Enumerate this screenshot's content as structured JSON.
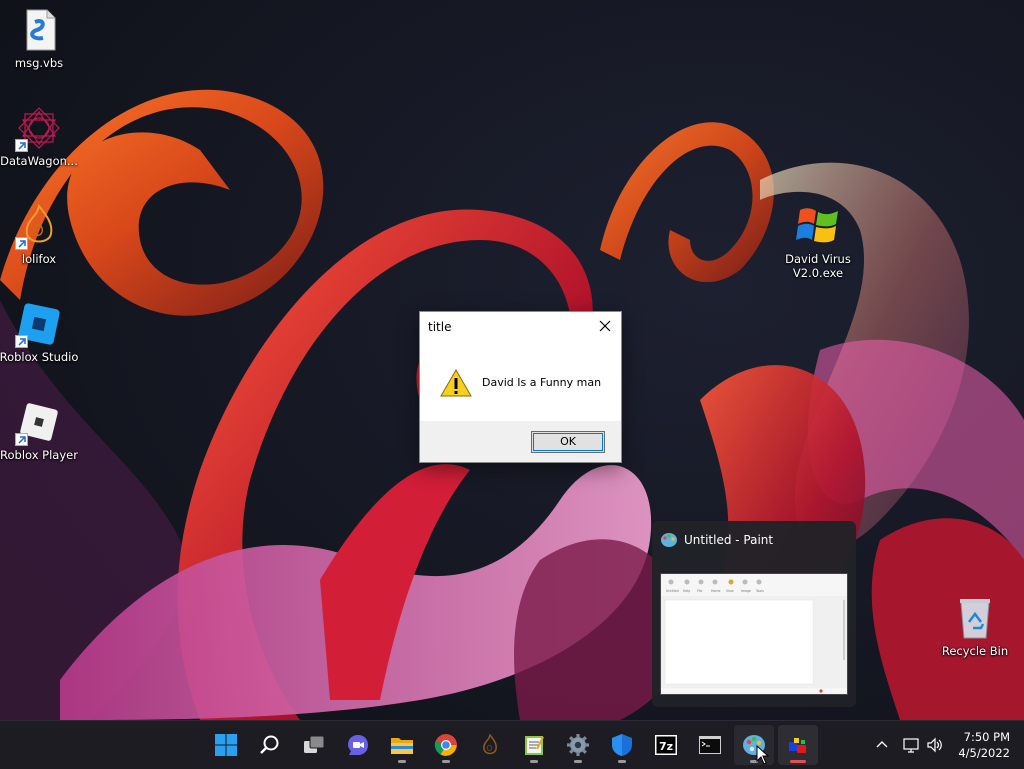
{
  "desktop": {
    "icons": [
      {
        "label": "msg.vbs"
      },
      {
        "label": "DataWagon..."
      },
      {
        "label": "lolifox"
      },
      {
        "label": "Roblox Studio"
      },
      {
        "label": "Roblox Player"
      },
      {
        "label": "David Virus V2.0.exe"
      },
      {
        "label": "Recycle Bin"
      }
    ]
  },
  "dialog": {
    "title": "title",
    "message": "David Is a Funny man",
    "ok_label": "OK",
    "icon": "warning-icon"
  },
  "preview": {
    "title": "Untitled - Paint",
    "thumb_labels": [
      "Untitled",
      "Help",
      "File",
      "Home",
      "View",
      "Image",
      "Tools"
    ]
  },
  "taskbar": {
    "apps": [
      {
        "name": "start",
        "icon": "windows-logo-icon"
      },
      {
        "name": "search",
        "icon": "search-icon"
      },
      {
        "name": "task-view",
        "icon": "task-view-icon"
      },
      {
        "name": "chat",
        "icon": "chat-icon"
      },
      {
        "name": "file-explorer",
        "icon": "folder-icon"
      },
      {
        "name": "chrome",
        "icon": "chrome-icon"
      },
      {
        "name": "lolifox",
        "icon": "lolifox-icon"
      },
      {
        "name": "notepad",
        "icon": "notepad-icon"
      },
      {
        "name": "settings",
        "icon": "gear-icon"
      },
      {
        "name": "security",
        "icon": "shield-icon"
      },
      {
        "name": "7zip",
        "icon": "7zip-icon",
        "text": "7z"
      },
      {
        "name": "terminal",
        "icon": "terminal-icon"
      },
      {
        "name": "paint",
        "icon": "paint-icon"
      },
      {
        "name": "app",
        "icon": "app-icon"
      }
    ],
    "tray": {
      "time": "7:50 PM",
      "date": "4/5/2022"
    }
  },
  "colors": {
    "accent": "#0078d7",
    "wallpaper_dark": "#14161f",
    "ribbon_orange": "#e0501a",
    "ribbon_red": "#c0142c",
    "taskbar": "#1c1c22"
  }
}
